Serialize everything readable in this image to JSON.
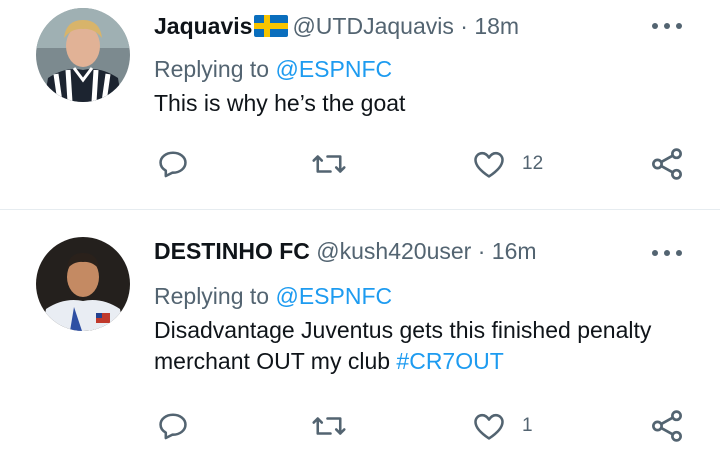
{
  "tweets": [
    {
      "display_name": "Jaquavis",
      "flag": "sweden-flag",
      "handle": "@UTDJaquavis",
      "separator": "·",
      "time": "18m",
      "replying_prefix": "Replying to",
      "replying_to": "@ESPNFC",
      "text": "This is why he’s the goat",
      "hashtag": "",
      "likes": "12"
    },
    {
      "display_name": "DESTINHO FC",
      "handle": "@kush420user",
      "separator": "·",
      "time": "16m",
      "replying_prefix": "Replying to",
      "replying_to": "@ESPNFC",
      "text": "Disadvantage Juventus gets this finished penalty merchant OUT my club",
      "hashtag": "#CR7OUT",
      "likes": "1"
    }
  ],
  "colors": {
    "link": "#1d9bf0",
    "secondary": "#536471",
    "primary": "#0f1419",
    "divider": "#e6ecf0"
  },
  "icons": [
    "reply-icon",
    "retweet-icon",
    "like-icon",
    "share-icon",
    "more-icon"
  ]
}
